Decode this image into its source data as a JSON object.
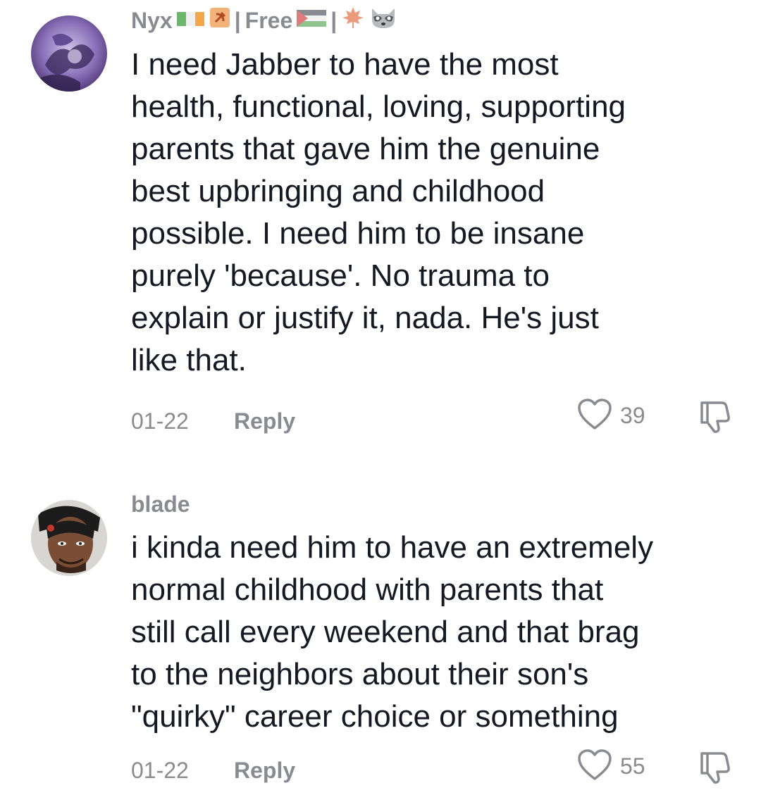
{
  "comments": [
    {
      "username": "Nyx",
      "username_separator_1": "|",
      "username_tag": "Free",
      "username_separator_2": "|",
      "badges": [
        "irish-flag-icon",
        "hammer-sickle-icon",
        "palestine-flag-icon",
        "maple-leaf-icon",
        "raccoon-icon"
      ],
      "text": "I need Jabber to have the most\nhealth, functional, loving, supporting\nparents that gave him the genuine\nbest upbringing and childhood\npossible. I need him to be insane\npurely 'because'. No trauma to\nexplain or justify it, nada. He's just\nlike that.",
      "date": "01-22",
      "reply_label": "Reply",
      "likes": "39"
    },
    {
      "username": "blade",
      "text": "i kinda need him to have an extremely\nnormal childhood with parents that\nstill call every weekend and that brag\nto the neighbors about their son's\n\"quirky\" career choice or something",
      "date": "01-22",
      "reply_label": "Reply",
      "likes": "55"
    }
  ],
  "colors": {
    "text_primary": "#161823",
    "text_secondary": "#8a8b91",
    "background": "#ffffff"
  }
}
